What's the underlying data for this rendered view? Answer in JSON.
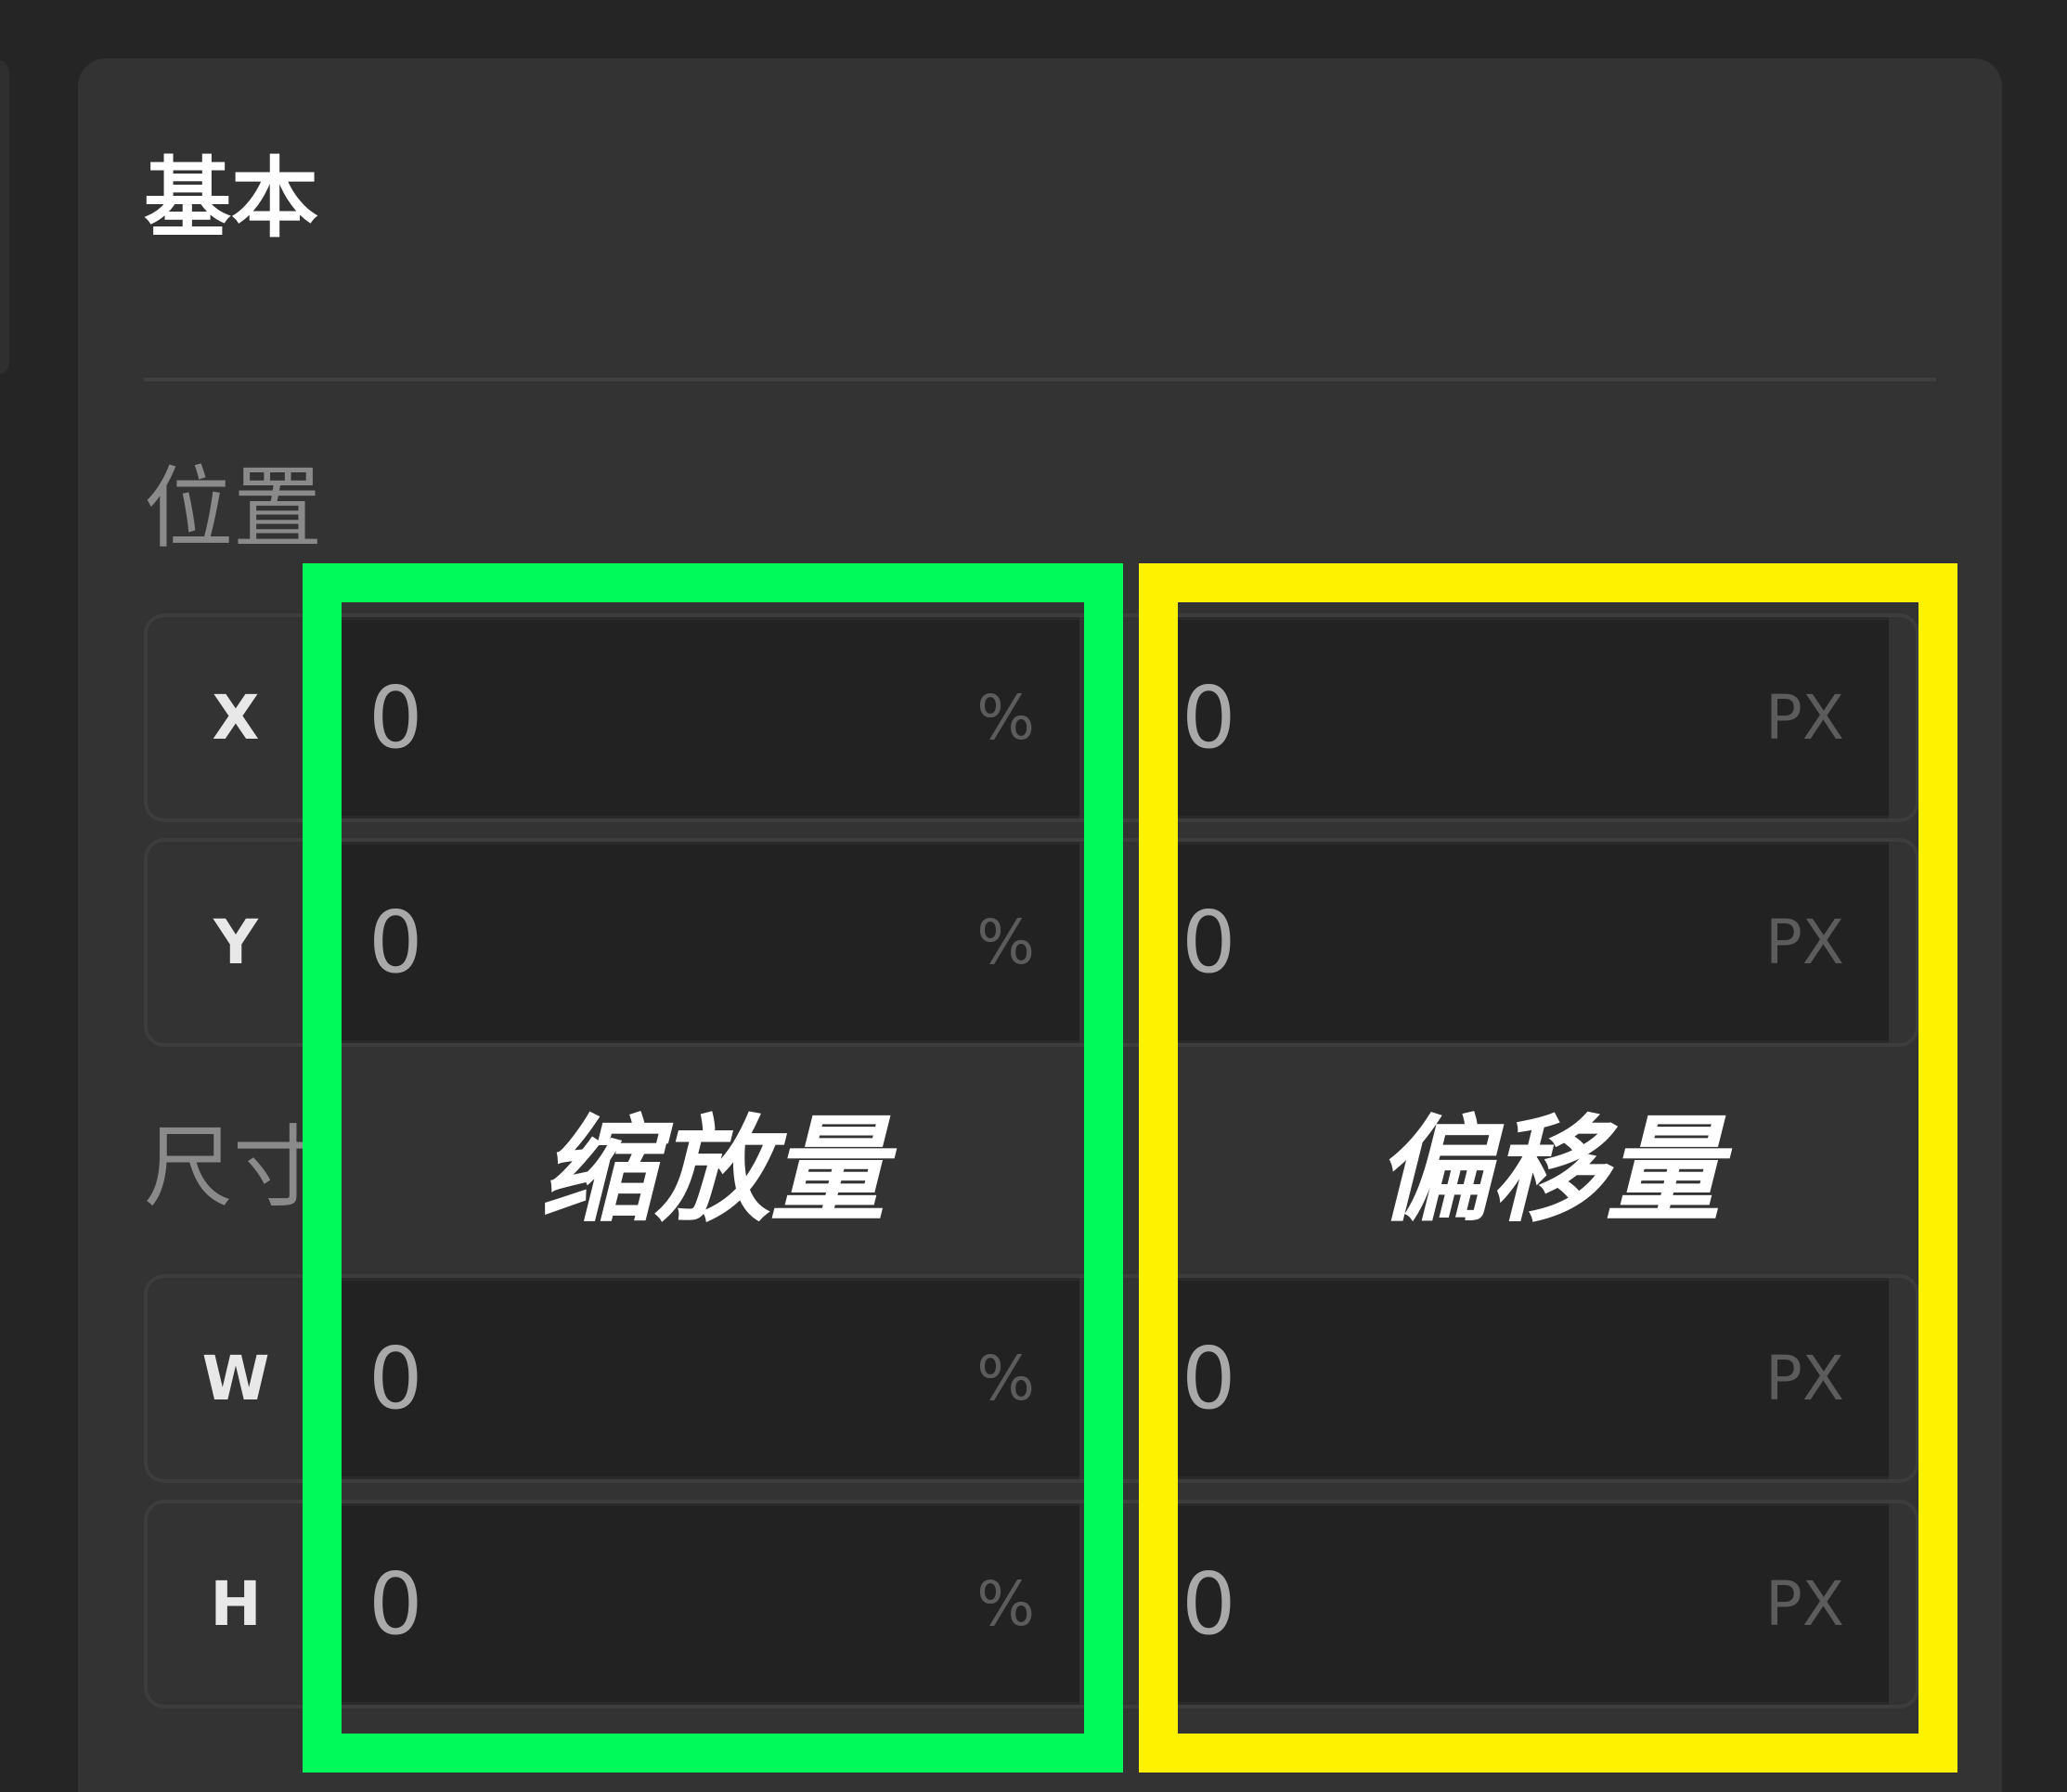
{
  "section": {
    "title": "基本"
  },
  "position_group": {
    "label": "位置",
    "rows": [
      {
        "axis": "X",
        "scale_value": "0",
        "scale_unit": "%",
        "offset_value": "0",
        "offset_unit": "PX"
      },
      {
        "axis": "Y",
        "scale_value": "0",
        "scale_unit": "%",
        "offset_value": "0",
        "offset_unit": "PX"
      }
    ]
  },
  "size_group": {
    "label": "尺寸",
    "rows": [
      {
        "axis": "W",
        "scale_value": "0",
        "scale_unit": "%",
        "offset_value": "0",
        "offset_unit": "PX"
      },
      {
        "axis": "H",
        "scale_value": "0",
        "scale_unit": "%",
        "offset_value": "0",
        "offset_unit": "PX"
      }
    ]
  },
  "annotations": {
    "scale_label": "缩放量",
    "offset_label": "偏移量",
    "scale_color": "#00fa5a",
    "offset_color": "#fff200"
  }
}
